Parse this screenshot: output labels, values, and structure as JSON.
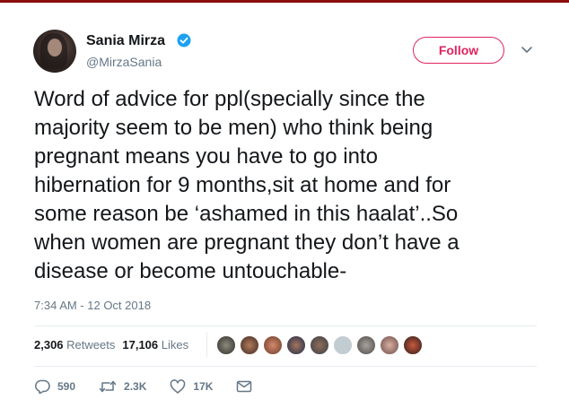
{
  "author": {
    "name": "Sania Mirza",
    "handle": "@MirzaSania",
    "verified": true
  },
  "follow_label": "Follow",
  "tweet": {
    "text": "Word of advice for ppl(specially since the\nmajority seem to be men) who think being\npregnant means you have to go into\nhibernation for 9 months,sit at home and for\nsome reason be ‘ashamed in this haalat’..So\nwhen women are pregnant they don’t have a\ndisease or become untouchable-",
    "timestamp": "7:34 AM - 12 Oct 2018"
  },
  "stats": {
    "retweets_count": "2,306",
    "retweets_label": "Retweets",
    "likes_count": "17,106",
    "likes_label": "Likes"
  },
  "actions": {
    "reply_count": "590",
    "retweet_count": "2.3K",
    "like_count": "17K"
  },
  "colors": {
    "accent": "#e0245e",
    "verified": "#1da1f2",
    "secondary_text": "#657786"
  },
  "icons": [
    "verified-badge-icon",
    "chevron-down-icon",
    "reply-icon",
    "retweet-icon",
    "like-icon",
    "direct-message-icon"
  ]
}
